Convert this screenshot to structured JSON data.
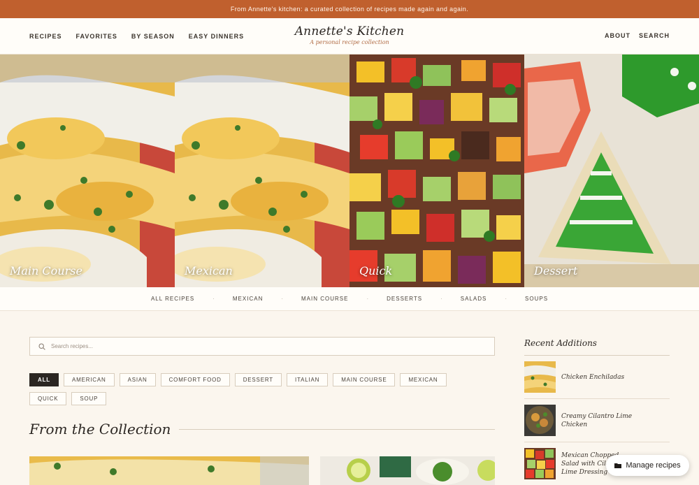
{
  "banner": {
    "text": "From Annette's kitchen: a curated collection of recipes made again and again."
  },
  "header": {
    "nav_left": [
      "RECIPES",
      "FAVORITES",
      "BY SEASON",
      "EASY DINNERS"
    ],
    "brand_name": "Annette's Kitchen",
    "brand_tagline": "A personal recipe collection",
    "nav_right": [
      "ABOUT",
      "SEARCH"
    ]
  },
  "hero": {
    "tiles": [
      {
        "label": "Main Course"
      },
      {
        "label": "Mexican"
      },
      {
        "label": "Quick"
      },
      {
        "label": "Dessert"
      }
    ]
  },
  "category_bar": [
    "ALL RECIPES",
    "MEXICAN",
    "MAIN COURSE",
    "DESSERTS",
    "SALADS",
    "SOUPS"
  ],
  "search": {
    "placeholder": "Search recipes...",
    "icon": "search-icon"
  },
  "filters": {
    "active": "ALL",
    "chips": [
      "ALL",
      "AMERICAN",
      "ASIAN",
      "COMFORT FOOD",
      "DESSERT",
      "ITALIAN",
      "MAIN COURSE",
      "MEXICAN",
      "QUICK",
      "SOUP"
    ]
  },
  "collection": {
    "title": "From the Collection"
  },
  "sidebar": {
    "title": "Recent Additions",
    "items": [
      {
        "title": "Chicken Enchiladas"
      },
      {
        "title": "Creamy Cilantro Lime Chicken"
      },
      {
        "title": "Mexican Chopped Salad with Cilantro Lime Dressing"
      }
    ]
  },
  "manage_button": {
    "label": "Manage recipes",
    "icon": "folder-icon"
  },
  "colors": {
    "accent": "#c0602e",
    "background": "#fbf6ee",
    "dark": "#2b2622"
  }
}
